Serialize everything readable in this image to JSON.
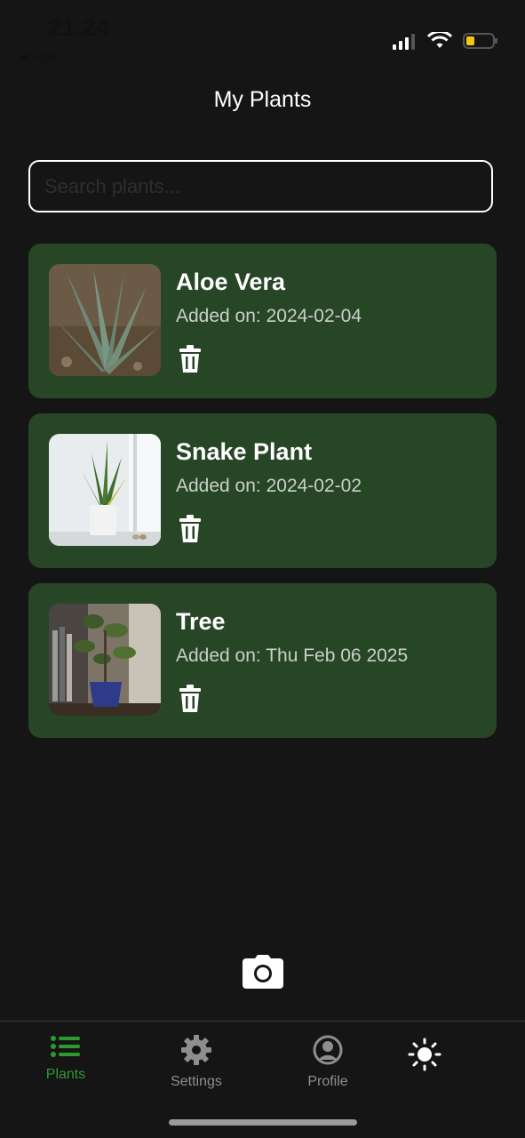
{
  "status": {
    "time": "21.24",
    "back_app": "◀ Haku",
    "battery_color": "#f5c518"
  },
  "header": {
    "title": "My Plants"
  },
  "search": {
    "placeholder": "Search plants..."
  },
  "plants": [
    {
      "name": "Aloe Vera",
      "date": "Added on: 2024-02-04",
      "image": "aloe-vera-photo"
    },
    {
      "name": "Snake Plant",
      "date": "Added on: 2024-02-02",
      "image": "snake-plant-photo"
    },
    {
      "name": "Tree",
      "date": "Added on: Thu Feb 06 2025",
      "image": "tree-photo"
    }
  ],
  "tabs": [
    {
      "label": "Plants",
      "icon": "list-icon",
      "active": true
    },
    {
      "label": "Settings",
      "icon": "gear-icon",
      "active": false
    },
    {
      "label": "Profile",
      "icon": "user-circle-icon",
      "active": false
    },
    {
      "label": "",
      "icon": "sun-icon",
      "active": false
    }
  ],
  "colors": {
    "background": "#151515",
    "card": "#274626",
    "accent": "#2e9a2e"
  }
}
